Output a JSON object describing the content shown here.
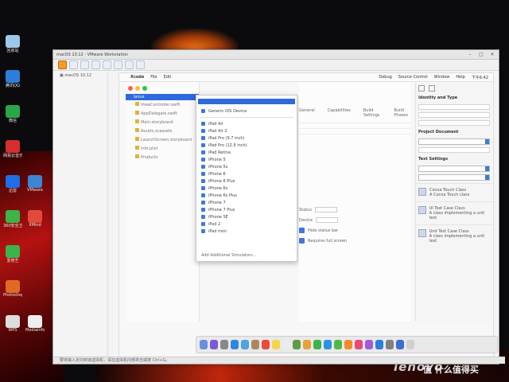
{
  "host_window": {
    "title": "macOS 10.12 - VMware Workstation"
  },
  "mac_menubar": {
    "app": "Xcode",
    "items": [
      "File",
      "Edit"
    ],
    "right_items": [
      "Debug",
      "Source Control",
      "Window",
      "Help"
    ],
    "clock": "下午6:42"
  },
  "navigator": {
    "root": "lance",
    "rows": [
      "ViewController.swift",
      "AppDelegate.swift",
      "Main.storyboard",
      "Assets.xcassets",
      "LaunchScreen.storyboard",
      "Info.plist",
      "Products"
    ]
  },
  "device_menu": {
    "items": [
      "Generic iOS Device",
      "iPad Air",
      "iPad Air 2",
      "iPad Pro (9.7 inch)",
      "iPad Pro (12.9 inch)",
      "iPad Retina",
      "iPhone 5",
      "iPhone 5s",
      "iPhone 6",
      "iPhone 6 Plus",
      "iPhone 6s",
      "iPhone 6s Plus",
      "iPhone 7",
      "iPhone 7 Plus",
      "iPhone SE",
      "iPad 2",
      "iPad mini"
    ],
    "footer": "Add Additional Simulators..."
  },
  "editor": {
    "tabs": [
      "General",
      "Capabilities",
      "Build Settings",
      "Build Phases"
    ],
    "fields": [
      "Status",
      "Device",
      "Hide status bar",
      "Requires full screen"
    ]
  },
  "inspector": {
    "heading": "Identity and Type",
    "section2": "Project Document",
    "section3": "Text Settings",
    "library": [
      {
        "title": "Cocoa Touch Class",
        "desc": "A Cocoa Touch class"
      },
      {
        "title": "UI Test Case Class",
        "desc": "A class implementing a unit test"
      },
      {
        "title": "Unit Test Case Class",
        "desc": "A class implementing a unit test"
      }
    ]
  },
  "statusbar": {
    "text": "要将输入定向到该虚拟机，请在虚拟机内部单击或按 Ctrl+G。"
  },
  "desktop_icons": [
    "回收站",
    "腾讯QQ",
    "微信",
    "网易云音乐",
    "迅雷",
    "360安全卫士",
    "爱奇艺",
    "Photoshop",
    "WPS",
    "VMware",
    "XMind",
    "MediaInfo"
  ],
  "brand": "lenovo",
  "watermark": "值 什么值得买"
}
